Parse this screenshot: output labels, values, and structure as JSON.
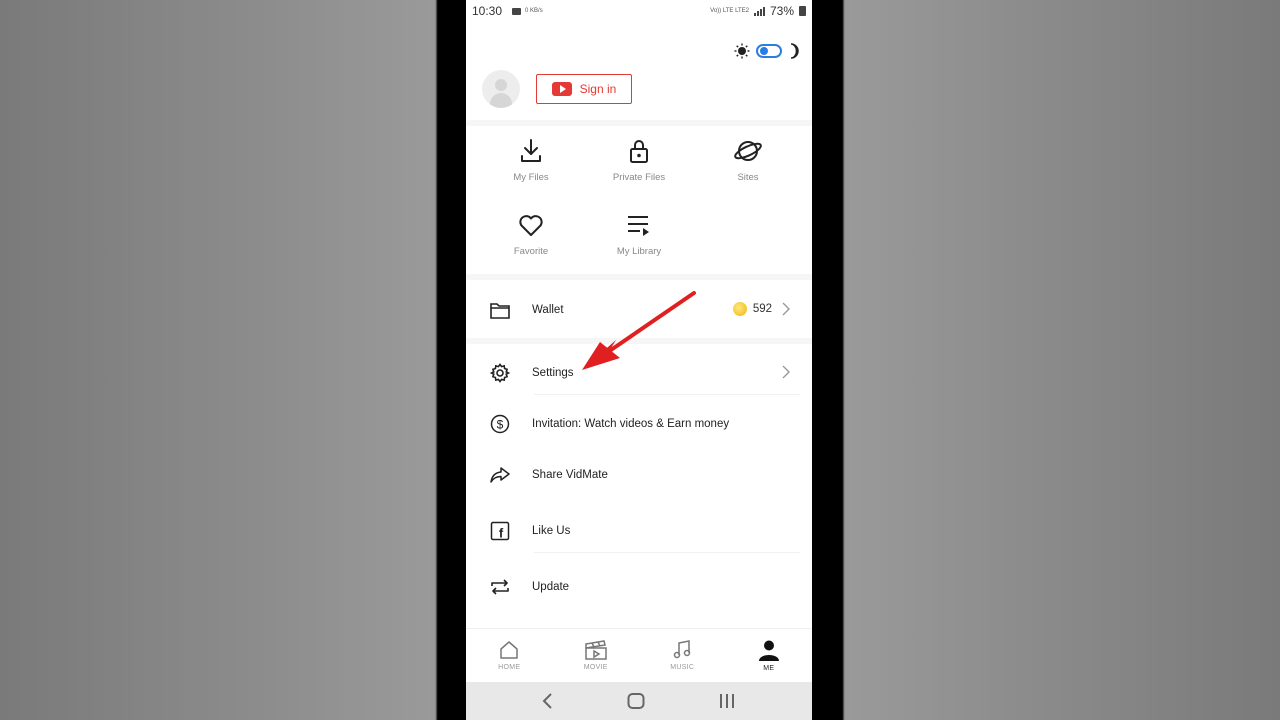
{
  "status_bar": {
    "time": "10:30",
    "speed": "0 KB/s",
    "network": "Vo)) LTE LTE2",
    "battery": "73%"
  },
  "profile": {
    "sign_in_label": "Sign in"
  },
  "quick_actions": [
    {
      "label": "My Files",
      "icon": "download-icon"
    },
    {
      "label": "Private Files",
      "icon": "lock-icon"
    },
    {
      "label": "Sites",
      "icon": "planet-icon"
    },
    {
      "label": "Favorite",
      "icon": "heart-icon"
    },
    {
      "label": "My Library",
      "icon": "library-icon"
    }
  ],
  "wallet": {
    "label": "Wallet",
    "coins": "592"
  },
  "menu": {
    "settings": "Settings",
    "invitation": "Invitation: Watch videos & Earn money",
    "share": "Share VidMate",
    "like": "Like Us",
    "update": "Update"
  },
  "bottom_nav": [
    {
      "label": "HOME",
      "icon": "home-icon"
    },
    {
      "label": "MOVIE",
      "icon": "clapperboard-icon"
    },
    {
      "label": "MUSIC",
      "icon": "music-icon"
    },
    {
      "label": "ME",
      "icon": "person-icon",
      "active": true
    }
  ],
  "colors": {
    "accent_red": "#e53935",
    "toggle_blue": "#2a7de1",
    "arrow_red": "#e02020"
  }
}
